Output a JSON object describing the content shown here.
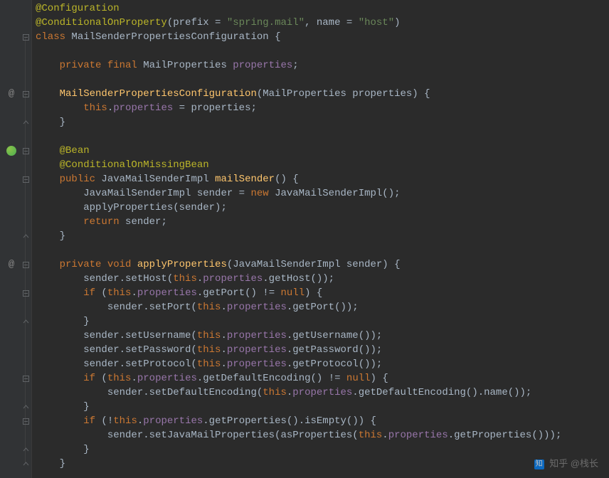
{
  "code": {
    "lines": [
      {
        "html": "<span class='annotation'>@Configuration</span>"
      },
      {
        "html": "<span class='annotation'>@ConditionalOnProperty</span>(prefix = <span class='string'>\"spring.mail\"</span>, name = <span class='string'>\"host\"</span>)"
      },
      {
        "html": "<span class='keyword'>class</span> MailSenderPropertiesConfiguration {"
      },
      {
        "html": ""
      },
      {
        "html": "    <span class='keyword'>private final</span> MailProperties <span class='field'>properties</span>;"
      },
      {
        "html": ""
      },
      {
        "html": "    <span class='method-name'>MailSenderPropertiesConfiguration</span>(MailProperties properties) {"
      },
      {
        "html": "        <span class='keyword'>this</span>.<span class='field'>properties</span> = properties;"
      },
      {
        "html": "    }"
      },
      {
        "html": ""
      },
      {
        "html": "    <span class='annotation'>@Bean</span>"
      },
      {
        "html": "    <span class='annotation'>@ConditionalOnMissingBean</span>"
      },
      {
        "html": "    <span class='keyword'>public</span> JavaMailSenderImpl <span class='method-name'>mailSender</span>() {"
      },
      {
        "html": "        JavaMailSenderImpl sender = <span class='keyword'>new</span> JavaMailSenderImpl();"
      },
      {
        "html": "        applyProperties(sender);"
      },
      {
        "html": "        <span class='keyword'>return</span> sender;"
      },
      {
        "html": "    }"
      },
      {
        "html": ""
      },
      {
        "html": "    <span class='keyword'>private void</span> <span class='method-name'>applyProperties</span>(JavaMailSenderImpl sender) {"
      },
      {
        "html": "        sender.setHost(<span class='keyword'>this</span>.<span class='field'>properties</span>.getHost());"
      },
      {
        "html": "        <span class='keyword'>if</span> (<span class='keyword'>this</span>.<span class='field'>properties</span>.getPort() != <span class='keyword'>null</span>) {"
      },
      {
        "html": "            sender.setPort(<span class='keyword'>this</span>.<span class='field'>properties</span>.getPort());"
      },
      {
        "html": "        }"
      },
      {
        "html": "        sender.setUsername(<span class='keyword'>this</span>.<span class='field'>properties</span>.getUsername());"
      },
      {
        "html": "        sender.setPassword(<span class='keyword'>this</span>.<span class='field'>properties</span>.getPassword());"
      },
      {
        "html": "        sender.setProtocol(<span class='keyword'>this</span>.<span class='field'>properties</span>.getProtocol());"
      },
      {
        "html": "        <span class='keyword'>if</span> (<span class='keyword'>this</span>.<span class='field'>properties</span>.getDefaultEncoding() != <span class='keyword'>null</span>) {"
      },
      {
        "html": "            sender.setDefaultEncoding(<span class='keyword'>this</span>.<span class='field'>properties</span>.getDefaultEncoding().name());"
      },
      {
        "html": "        }"
      },
      {
        "html": "        <span class='keyword'>if</span> (!<span class='keyword'>this</span>.<span class='field'>properties</span>.getProperties().isEmpty()) {"
      },
      {
        "html": "            sender.setJavaMailProperties(asProperties(<span class='keyword'>this</span>.<span class='field'>properties</span>.getProperties()));"
      },
      {
        "html": "        }"
      },
      {
        "html": "    }"
      }
    ],
    "gutterIcons": [
      {
        "line": 6,
        "type": "at"
      },
      {
        "line": 10,
        "type": "bean"
      },
      {
        "line": 18,
        "type": "at"
      }
    ],
    "foldIcons": [
      {
        "line": 2,
        "type": "minus"
      },
      {
        "line": 6,
        "type": "minus"
      },
      {
        "line": 8,
        "type": "up"
      },
      {
        "line": 10,
        "type": "minus"
      },
      {
        "line": 12,
        "type": "minus"
      },
      {
        "line": 16,
        "type": "up"
      },
      {
        "line": 18,
        "type": "minus"
      },
      {
        "line": 20,
        "type": "minus"
      },
      {
        "line": 22,
        "type": "up"
      },
      {
        "line": 26,
        "type": "minus"
      },
      {
        "line": 28,
        "type": "up"
      },
      {
        "line": 29,
        "type": "minus"
      },
      {
        "line": 31,
        "type": "up"
      },
      {
        "line": 32,
        "type": "up"
      }
    ],
    "foldLines": [
      {
        "from": 2,
        "to": 32
      }
    ]
  },
  "watermark": {
    "logo": "知",
    "text": "知乎 @栈长"
  }
}
